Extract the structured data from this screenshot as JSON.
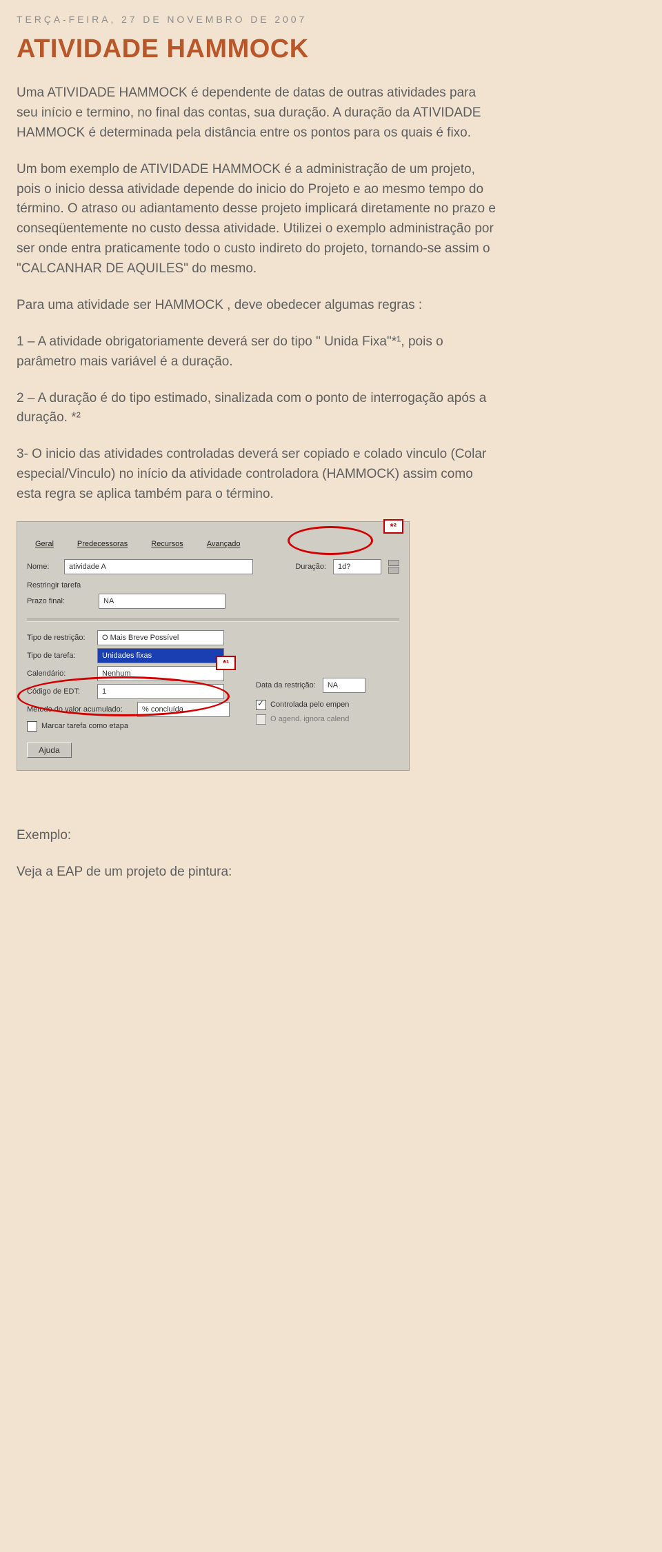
{
  "post": {
    "date": "TERÇA-FEIRA, 27 DE NOVEMBRO DE 2007",
    "title": "ATIVIDADE HAMMOCK",
    "p1": "Uma ATIVIDADE HAMMOCK é dependente de datas de outras atividades para seu início e termino, no final das contas, sua duração. A duração da ATIVIDADE HAMMOCK é determinada pela distância entre os pontos para os quais é fixo.",
    "p2": "Um bom exemplo de ATIVIDADE HAMMOCK é a administração de um projeto, pois o inicio dessa atividade depende do inicio do Projeto e ao mesmo tempo do término. O atraso ou adiantamento desse projeto implicará diretamente no prazo e conseqüentemente no custo dessa atividade. Utilizei o exemplo administração por ser onde entra praticamente todo o custo indireto do projeto, tornando-se assim o \"CALCANHAR DE AQUILES\" do mesmo.",
    "p3": "Para uma atividade ser HAMMOCK , deve obedecer algumas regras :",
    "p4": "1 – A atividade obrigatoriamente deverá ser do tipo \" Unida Fixa\"*¹, pois o parâmetro mais variável é a duração.",
    "p5": "2 – A duração é do tipo estimado, sinalizada com o ponto de interrogação após a duração. *²",
    "p6": "3- O inicio das atividades controladas deverá ser copiado e colado vinculo (Colar especial/Vinculo) no início da atividade controladora (HAMMOCK) assim como esta regra se aplica também para o término.",
    "exemplo_label": "Exemplo:",
    "eap_line": "Veja a EAP de um projeto de pintura:"
  },
  "shot": {
    "tabs": {
      "geral": "Geral",
      "pred": "Predecessoras",
      "rec": "Recursos",
      "adv": "Avançado"
    },
    "nome_lbl": "Nome:",
    "nome_val": "atividade A",
    "dur_lbl": "Duração:",
    "dur_val": "1d?",
    "restr_lbl": "Restringir tarefa",
    "prazo_lbl": "Prazo final:",
    "na": "NA",
    "tipo_restr_lbl": "Tipo de restrição:",
    "tipo_restr_val": "O Mais Breve Possível",
    "data_restr_lbl": "Data da restrição:",
    "tipo_tarefa_lbl": "Tipo de tarefa:",
    "tipo_tarefa_val": "Unidades fixas",
    "ctrl_emp": "Controlada pelo empen",
    "calend_lbl": "Calendário:",
    "calend_val": "Nenhum",
    "agend_ign": "O agend. ignora calend",
    "edt_lbl": "Código de EDT:",
    "edt_val": "1",
    "mva_lbl": "Método do valor acumulado:",
    "mva_val": "% concluída",
    "marcar_etapa": "Marcar tarefa como etapa",
    "ajuda": "Ajuda",
    "note1": "*¹",
    "note2": "*²"
  }
}
